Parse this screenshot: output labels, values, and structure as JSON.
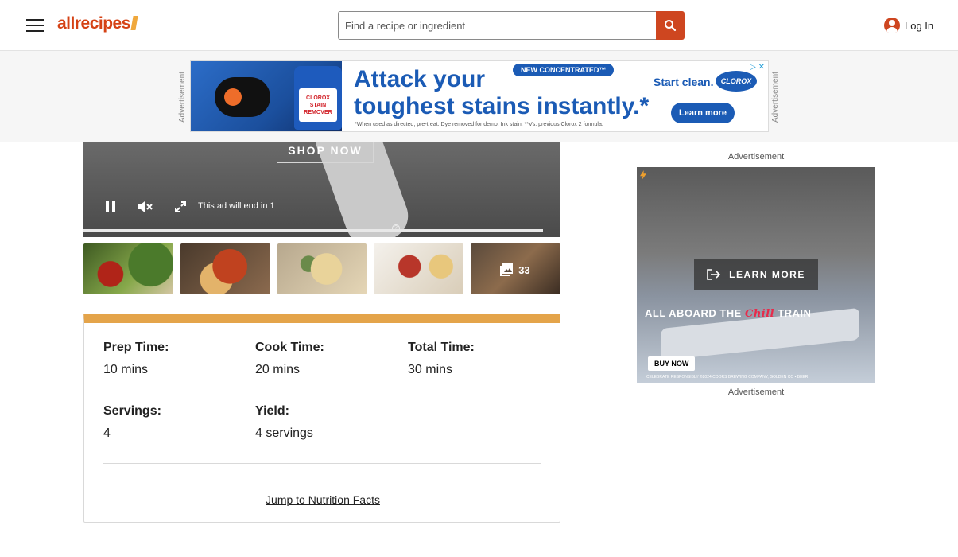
{
  "header": {
    "logo_text": "allrecipes",
    "search_placeholder": "Find a recipe or ingredient",
    "login_label": "Log In"
  },
  "ad_band": {
    "side_label": "Advertisement",
    "new_pill": "NEW CONCENTRATED™",
    "headline_line1": "Attack your",
    "headline_line2": "toughest stains instantly.*",
    "fine_print": "*When used as directed, pre-treat. Dye removed for demo. Ink stain. **Vs. previous Clorox 2 formula.",
    "start_clean": "Start clean.",
    "brand": "CLOROX",
    "bottle_label": "CLOROX STAIN REMOVER",
    "cta": "Learn more"
  },
  "video": {
    "shop_now": "SHOP NOW",
    "ad_countdown": "This ad will end in 1"
  },
  "gallery": {
    "photo_count": "33"
  },
  "details": {
    "prep_label": "Prep Time:",
    "prep_value": "10 mins",
    "cook_label": "Cook Time:",
    "cook_value": "20 mins",
    "total_label": "Total Time:",
    "total_value": "30 mins",
    "servings_label": "Servings:",
    "servings_value": "4",
    "yield_label": "Yield:",
    "yield_value": "4 servings",
    "jump_link": "Jump to Nutrition Facts"
  },
  "sidebar_ad": {
    "label_top": "Advertisement",
    "label_bottom": "Advertisement",
    "cta": "LEARN MORE",
    "aboard_prefix": "ALL ABOARD THE",
    "aboard_word": "Chill",
    "aboard_suffix": "TRAIN",
    "buy_now": "BUY NOW",
    "fine_print": "CELEBRATE RESPONSIBLY ©2024 COORS BREWING COMPANY, GOLDEN CO • BEER"
  },
  "colors": {
    "brand_orange": "#ce4620",
    "card_accent": "#e4a44a",
    "clorox_blue": "#1b5bb5"
  }
}
